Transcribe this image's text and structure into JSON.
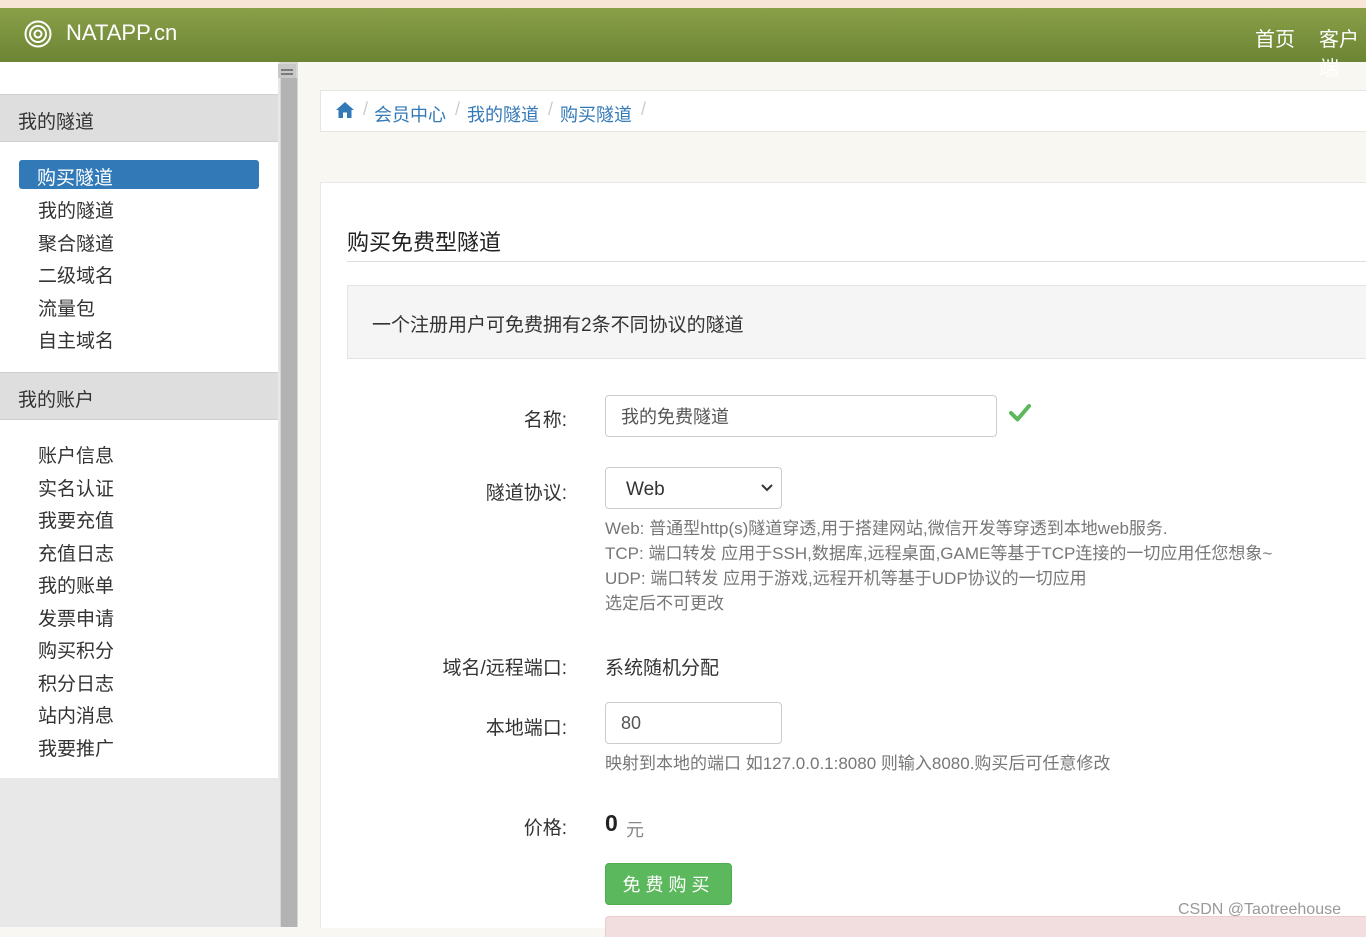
{
  "navbar": {
    "brand": "NATAPP.cn",
    "links": [
      "首页",
      "客户端"
    ]
  },
  "sidebar": {
    "sections": [
      {
        "title": "我的隧道",
        "items": [
          "购买隧道",
          "我的隧道",
          "聚合隧道",
          "二级域名",
          "流量包",
          "自主域名"
        ],
        "active_index": 0
      },
      {
        "title": "我的账户",
        "items": [
          "账户信息",
          "实名认证",
          "我要充值",
          "充值日志",
          "我的账单",
          "发票申请",
          "购买积分",
          "积分日志",
          "站内消息",
          "我要推广"
        ]
      }
    ]
  },
  "breadcrumb": [
    "会员中心",
    "我的隧道",
    "购买隧道"
  ],
  "page": {
    "title": "购买免费型隧道",
    "notice": "一个注册用户可免费拥有2条不同协议的隧道"
  },
  "form": {
    "name_label": "名称:",
    "name_value": "我的免费隧道",
    "protocol_label": "隧道协议:",
    "protocol_value": "Web",
    "protocol_help": [
      "Web: 普通型http(s)隧道穿透,用于搭建网站,微信开发等穿透到本地web服务.",
      "TCP: 端口转发 应用于SSH,数据库,远程桌面,GAME等基于TCP连接的一切应用任您想象~",
      "UDP: 端口转发 应用于游戏,远程开机等基于UDP协议的一切应用",
      "选定后不可更改"
    ],
    "domain_label": "域名/远程端口:",
    "domain_value": "系统随机分配",
    "local_port_label": "本地端口:",
    "local_port_value": "80",
    "local_port_help": "映射到本地的端口 如127.0.0.1:8080 则输入8080.购买后可任意修改",
    "price_label": "价格:",
    "price_value": "0",
    "price_unit": "元",
    "buy_button": "免费购买"
  },
  "watermark": "CSDN @Taotreehouse",
  "colors": {
    "navbar": "#7a9340",
    "link": "#3279b8",
    "active": "#3279b8",
    "success": "#5cb85c",
    "check": "#5cb85c"
  },
  "icons": {
    "brand": "spiral-logo-icon",
    "home": "home-icon",
    "valid": "check-icon",
    "select": "chevron-down-icon"
  }
}
